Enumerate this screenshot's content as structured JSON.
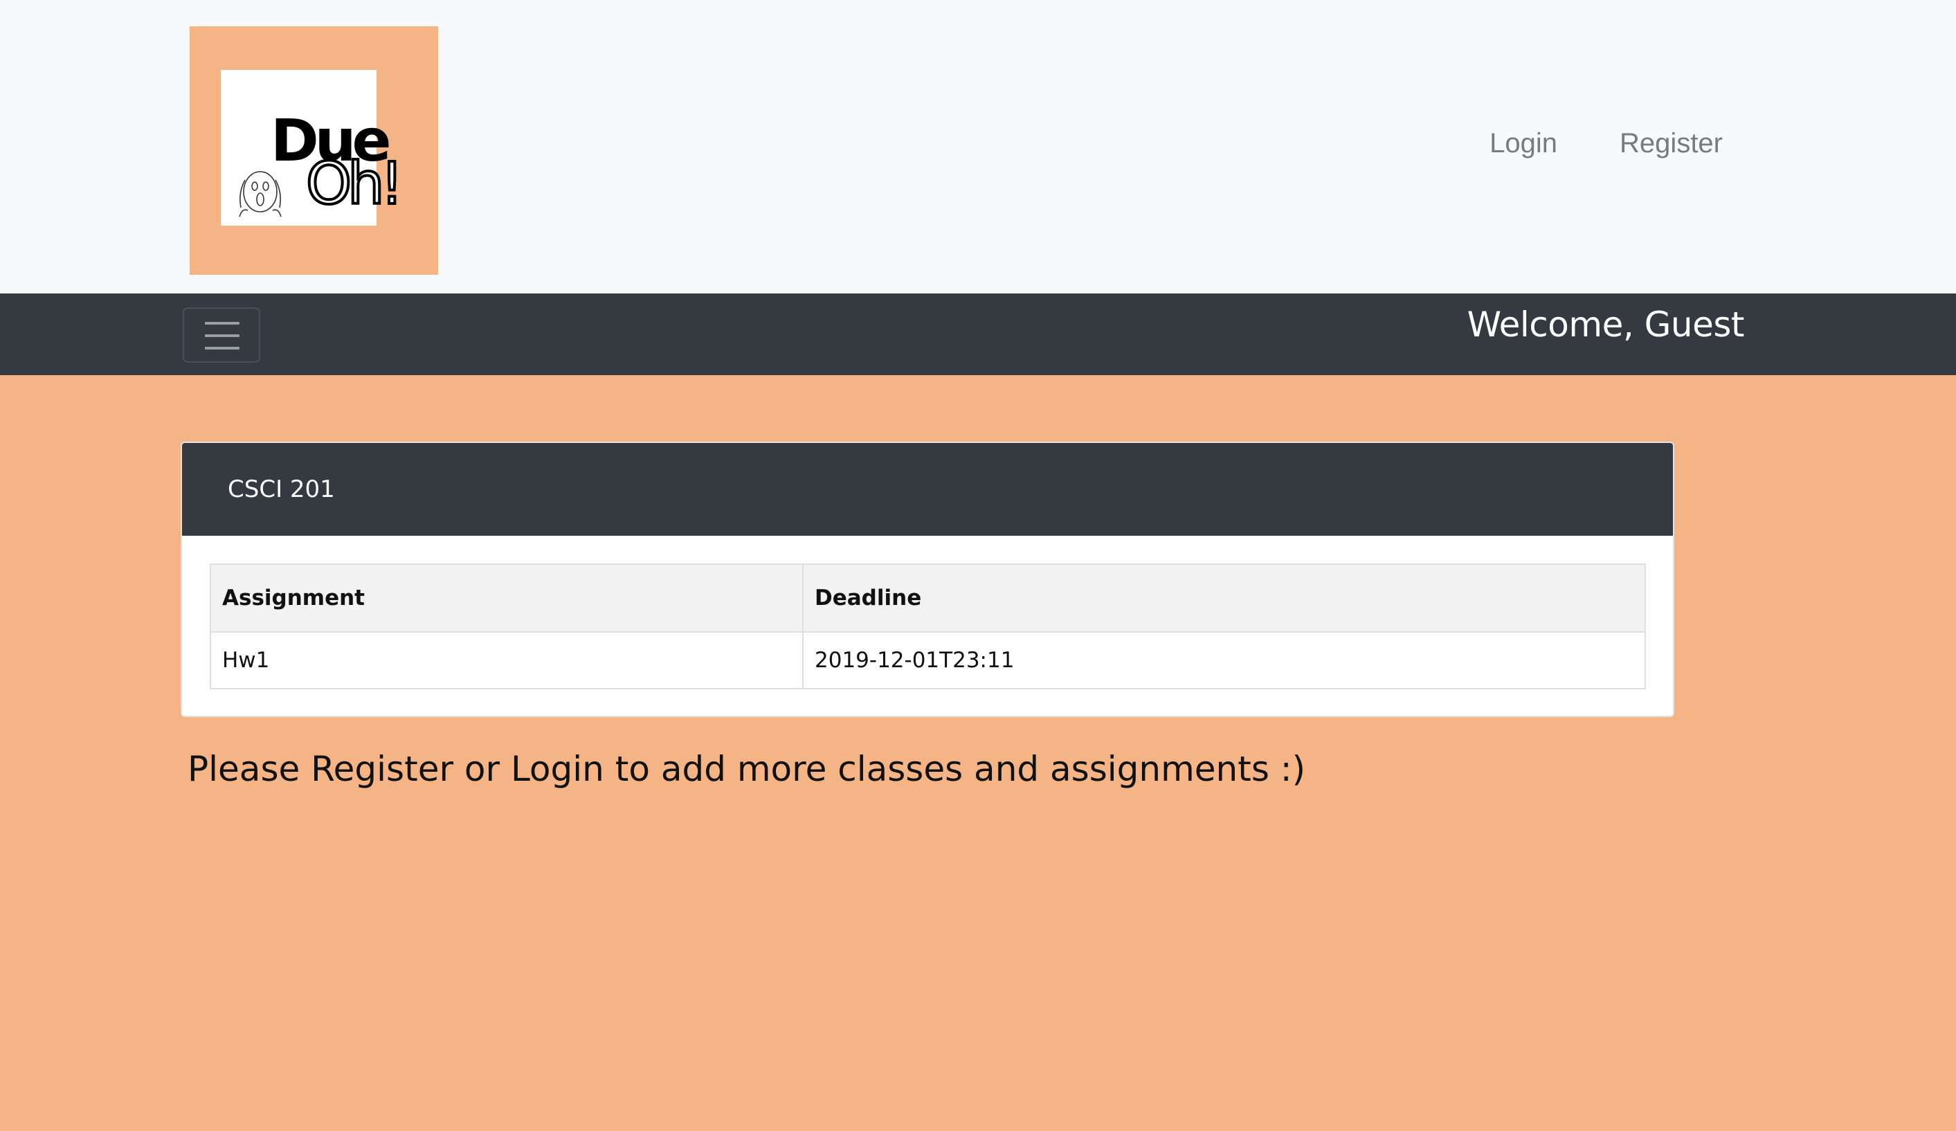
{
  "header": {
    "logo": {
      "line1": "Due",
      "line2": "Oh!",
      "icon": "screaming-face-icon"
    },
    "nav": {
      "login_label": "Login",
      "register_label": "Register"
    }
  },
  "navbar": {
    "menu_icon": "hamburger-icon",
    "welcome_text": "Welcome, Guest"
  },
  "course_card": {
    "title": "CSCI 201",
    "columns": [
      "Assignment",
      "Deadline"
    ],
    "rows": [
      {
        "assignment": "Hw1",
        "deadline": "2019-12-01T23:11"
      }
    ]
  },
  "notice": "Please Register or Login to add more classes and assignments :)",
  "colors": {
    "page_background": "#f4b485",
    "header_background": "#f8f9fa",
    "navbar_background": "#343a40",
    "logo_background": "#f4b485"
  }
}
